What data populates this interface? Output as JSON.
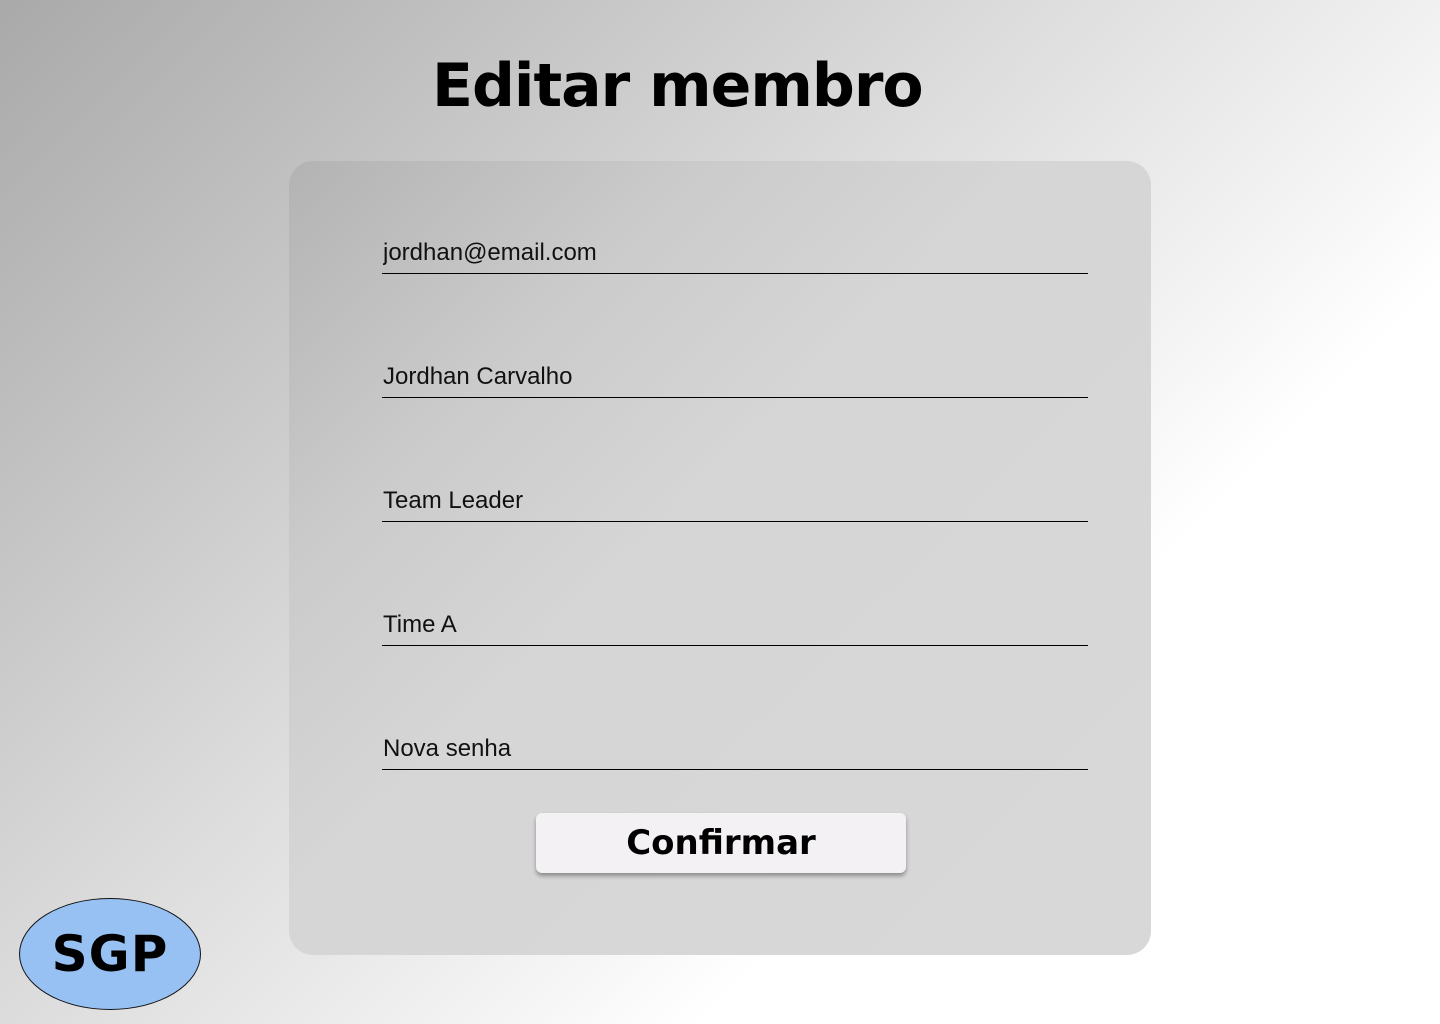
{
  "page": {
    "title": "Editar membro"
  },
  "form": {
    "email_value": "jordhan@email.com",
    "name_value": "Jordhan Carvalho",
    "role_value": "Team Leader",
    "team_value": "Time A",
    "password_placeholder": "Nova senha",
    "confirm_label": "Confirmar"
  },
  "logo": {
    "text": "SGP"
  },
  "colors": {
    "logo_fill": "#97c1f2",
    "button_fill": "#f3f1f4",
    "card_fill": "#d6d6d6"
  }
}
